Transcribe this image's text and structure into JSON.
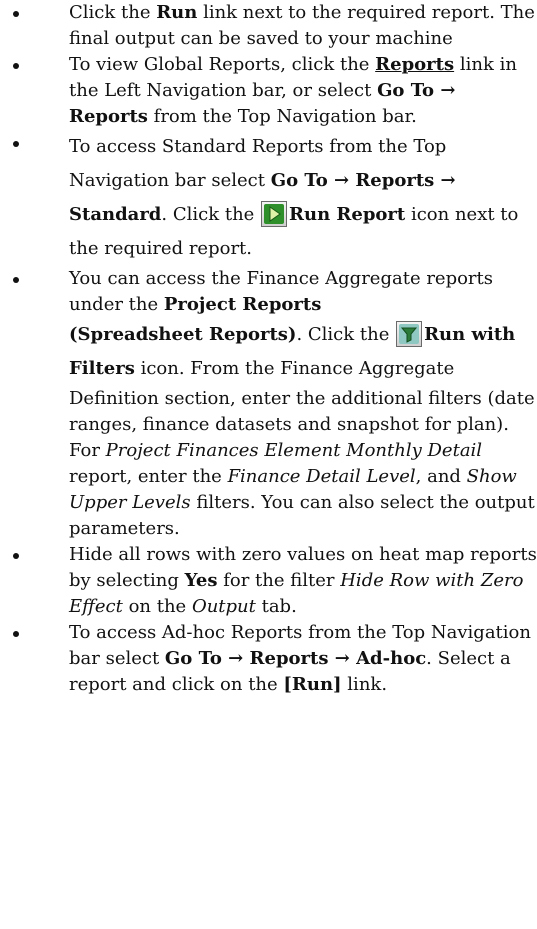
{
  "bullets": {
    "b1": {
      "t1": "Click the ",
      "run": "Run",
      "t2": " link next to the required report. The final output can be saved to your machine"
    },
    "b2": {
      "t1": "To view Global Reports, click the ",
      "reports_link": "Reports",
      "t2": " link in the Left Navigation bar, or select ",
      "goto": "Go To",
      "arrow": " → ",
      "reports": "Reports",
      "t3": " from the Top Navigation bar."
    },
    "b3": {
      "t1": "To access Standard Reports from the Top Navigation bar select ",
      "goto": "Go To",
      "arrow1": " → ",
      "reports": "Reports",
      "arrow2": " → ",
      "standard": "Standard",
      "t2": ".  Click the ",
      "icon": "run-report-icon",
      "run_report": "Run Report",
      "t3": " icon next to the required report."
    },
    "b4": {
      "t1": "You can access the Finance Aggregate reports under the ",
      "project_reports": "Project Reports",
      "spreadsheet": "(Spreadsheet Reports)",
      "t2": ". Click the ",
      "icon": "run-with-filters-icon",
      "run_with_filters": "Run with Filters",
      "t3": " icon. From the Finance Aggregate Definition section, enter the additional filters (date ranges, finance datasets and snapshot for plan). For ",
      "pfemd": "Project Finances Element Monthly Detail",
      "t4": " report, enter the ",
      "fdl": "Finance Detail Level",
      "t5": ", and ",
      "sul": "Show Upper Levels",
      "t6": " filters. You can also select the output parameters."
    },
    "b5": {
      "t1": "Hide all rows with zero values on heat map reports by selecting ",
      "yes": "Yes",
      "t2": " for the filter ",
      "hrze": "Hide Row with Zero Effect",
      "t3": " on the ",
      "output": "Output",
      "t4": " tab."
    },
    "b6": {
      "t1": "To access Ad-hoc Reports from the Top Navigation bar select ",
      "goto": "Go To",
      "arrow1": " → ",
      "reports": "Reports",
      "arrow2": " → ",
      "adhoc": "Ad-hoc",
      "t2": ". Select a report and click on the ",
      "run": "[Run]",
      "t3": " link."
    }
  }
}
